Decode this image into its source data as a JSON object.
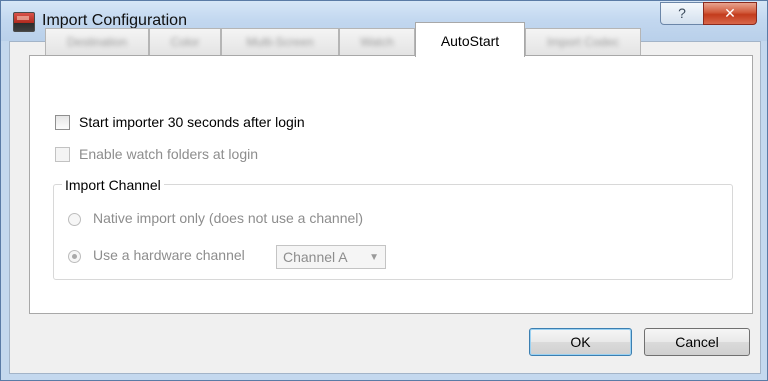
{
  "window": {
    "title": "Import Configuration",
    "help_glyph": "?",
    "close_glyph": "✕",
    "icon": "app-icon"
  },
  "tabs": [
    {
      "label": "Destination",
      "active": false
    },
    {
      "label": "Color",
      "active": false
    },
    {
      "label": "Multi-Screen",
      "active": false
    },
    {
      "label": "Watch",
      "active": false
    },
    {
      "label": "AutoStart",
      "active": true
    },
    {
      "label": "Import Codec",
      "active": false
    }
  ],
  "autostart": {
    "start_importer_label": "Start importer 30 seconds after login",
    "start_importer_checked": false,
    "watch_folders_label": "Enable watch folders at login",
    "watch_folders_checked": false,
    "watch_folders_enabled": false
  },
  "import_channel": {
    "group_title": "Import Channel",
    "native_label": "Native import only (does not use a channel)",
    "native_selected": false,
    "hardware_label": "Use a hardware channel",
    "hardware_selected": true,
    "channel_value": "Channel A",
    "enabled": false
  },
  "buttons": {
    "ok_label": "OK",
    "cancel_label": "Cancel"
  }
}
